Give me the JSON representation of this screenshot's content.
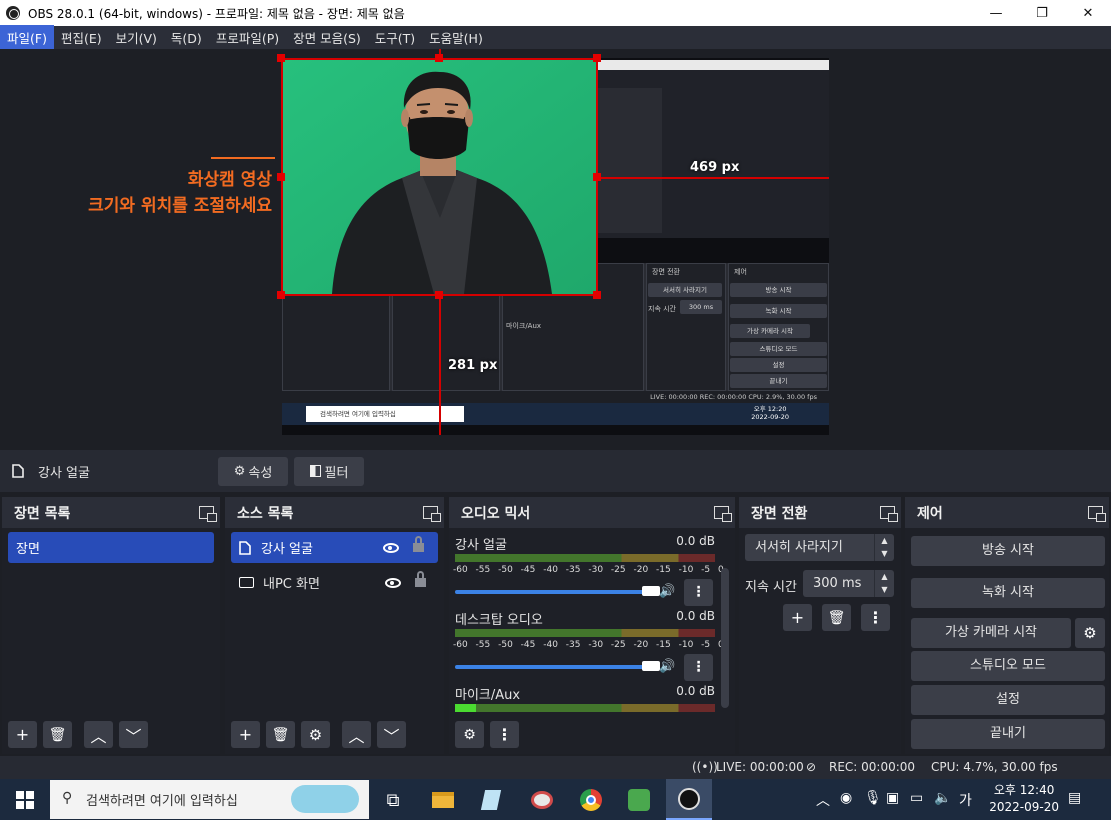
{
  "window": {
    "title": "OBS 28.0.1 (64-bit, windows) - 프로파일: 제목 없음 - 장면: 제목 없음",
    "minimize": "—",
    "maximize": "❐",
    "close": "✕"
  },
  "menu": [
    "파일(F)",
    "편집(E)",
    "보기(V)",
    "독(D)",
    "프로파일(P)",
    "장면 모음(S)",
    "도구(T)",
    "도움말(H)"
  ],
  "preview": {
    "annotation_line1": "화상캠 영상",
    "annotation_line2": "크기와 위치를 조절하세요",
    "width_label": "469 px",
    "height_label": "281 px",
    "nested_scene_panel": "장면 전환",
    "nested_controls_panel": "제어",
    "nested_mic": "마이크/Aux",
    "nested_fade": "서서히 사라지기",
    "nested_duration_label": "지속 시간",
    "nested_duration_value": "300 ms",
    "nested_start_stream": "방송 시작",
    "nested_start_record": "녹화 시작",
    "nested_virtual_cam": "가상 카메라 시작",
    "nested_studio": "스튜디오 모드",
    "nested_settings": "설정",
    "nested_exit": "끝내기",
    "nested_status": "LIVE: 00:00:00    REC: 00:00:00    CPU: 2.9%, 30.00 fps",
    "nested_search": "검색하려면 여기에 입력하십",
    "nested_time": "오후 12:20",
    "nested_date": "2022-09-20"
  },
  "source_toolbar": {
    "source_name": "강사 얼굴",
    "properties": "속성",
    "filters": "필터"
  },
  "scenes": {
    "title": "장면 목록",
    "items": [
      "장면"
    ]
  },
  "sources": {
    "title": "소스 목록",
    "items": [
      "강사 얼굴",
      "내PC 화면"
    ]
  },
  "mixer": {
    "title": "오디오 믹서",
    "scale": "-60 -55 -50 -45 -40 -35 -30 -25 -20 -15 -10 -5 0",
    "channels": [
      {
        "name": "강사 얼굴",
        "db": "0.0 dB"
      },
      {
        "name": "데스크탑 오디오",
        "db": "0.0 dB"
      },
      {
        "name": "마이크/Aux",
        "db": "0.0 dB"
      }
    ]
  },
  "transitions": {
    "title": "장면 전환",
    "selected": "서서히 사라지기",
    "duration_label": "지속 시간",
    "duration_value": "300 ms"
  },
  "controls": {
    "title": "제어",
    "start_stream": "방송 시작",
    "start_record": "녹화 시작",
    "virtual_cam": "가상 카메라 시작",
    "studio_mode": "스튜디오 모드",
    "settings": "설정",
    "exit": "끝내기"
  },
  "status": {
    "live": "LIVE: 00:00:00",
    "rec": "REC: 00:00:00",
    "cpu": "CPU: 4.7%, 30.00 fps"
  },
  "taskbar": {
    "search_placeholder": "검색하려면 여기에 입력하십",
    "time": "오후 12:40",
    "date": "2022-09-20",
    "ime": "가"
  },
  "colors": {
    "accent": "#284cb8",
    "annotation": "#f26b21",
    "selection": "#d40000",
    "chroma": "#24b774"
  }
}
